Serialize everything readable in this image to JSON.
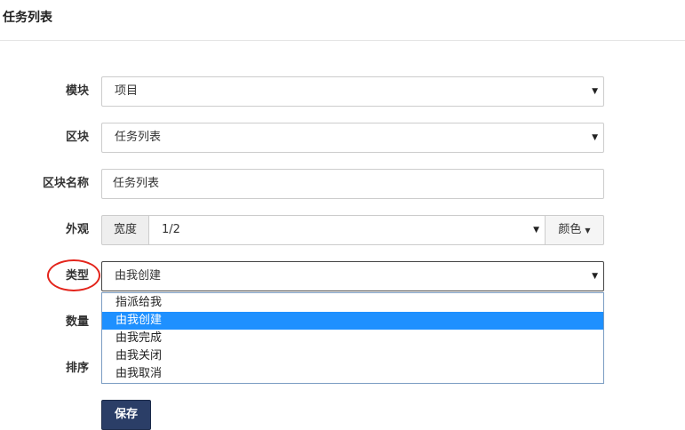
{
  "header": {
    "title": "任务列表"
  },
  "form": {
    "module": {
      "label": "模块",
      "value": "项目"
    },
    "block": {
      "label": "区块",
      "value": "任务列表"
    },
    "block_name": {
      "label": "区块名称",
      "value": "任务列表"
    },
    "appearance": {
      "label": "外观",
      "width_addon": "宽度",
      "width_value": "1/2",
      "color_button": "颜色"
    },
    "type": {
      "label": "类型",
      "value": "由我创建",
      "options": [
        "指派给我",
        "由我创建",
        "由我完成",
        "由我关闭",
        "由我取消"
      ],
      "selected_index": 1
    },
    "count": {
      "label": "数量"
    },
    "order": {
      "label": "排序"
    },
    "save_label": "保存"
  },
  "colors": {
    "highlight_circle": "#e3241b",
    "selected_option": "#1e90ff",
    "save_button": "#2b3e67"
  }
}
